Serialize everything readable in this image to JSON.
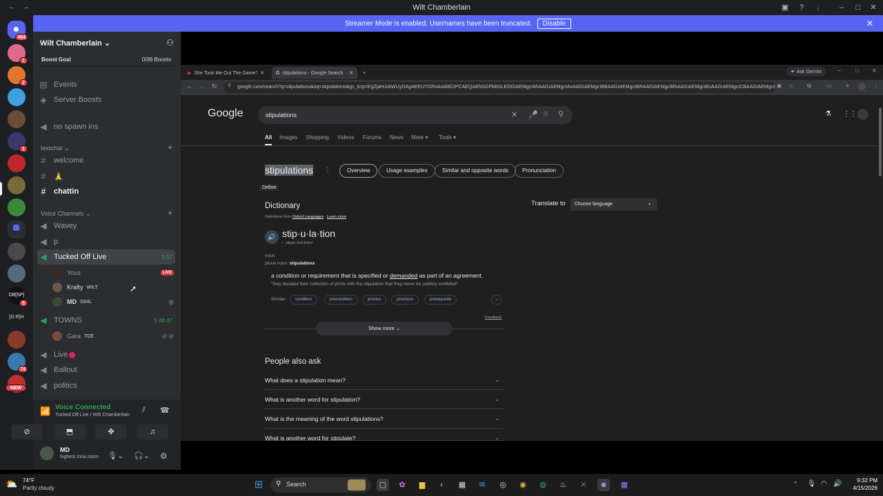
{
  "window": {
    "title": "Wilt Chamberlain"
  },
  "rail": {
    "home_badge": "464",
    "badges": [
      "1",
      "2",
      "1",
      "5",
      "74"
    ],
    "new_label": "NEW"
  },
  "banner": {
    "text": "Streamer Mode is enabled. Usernames have been truncated.",
    "button": "Disable"
  },
  "server": {
    "name": "Wilt Chamberlain",
    "boost_label": "Boost Goal",
    "boost_count": "0/36 Boosts"
  },
  "channels": {
    "events": "Events",
    "server_boosts": "Server Boosts",
    "no_spawn": "no spawn ins",
    "cat_text": "textchat",
    "welcome": "welcome",
    "emoji_channel": "🙏",
    "chattin": "chattin",
    "cat_voice": "Voice Channels",
    "wavey": "Wavey",
    "p": "p",
    "tucked": "Tucked Off Live",
    "tucked_time": "5:57",
    "yous": "Yous",
    "live_badge": "LIVE",
    "krafty": "Krafty",
    "krafty_tag": "WILT",
    "md": "MD",
    "md_tag": "SS4L",
    "towns": "TOWNS",
    "towns_time": "5:48:47",
    "gara": "Gara",
    "gara_tag": "TDE",
    "live": "Live",
    "ballout": "Ballout",
    "politics": "politics"
  },
  "voice": {
    "status": "Voice Connected",
    "location": "Tucked Off Live / Wilt Chamberlain"
  },
  "user": {
    "name": "MD",
    "status": "highest inna room"
  },
  "browser": {
    "tab1": "She Took Me Out The Game?! '",
    "tab2": "stipulations - Google Search",
    "gemini": "Ask Gemini",
    "url": "google.com/search?q=stipulations&oq=stipulations&gs_lcrp=EgZjaHJvbWUyDAgAEEUYORxAxiABDIPCAEQABhGGPkBGLEDGIAEMgcIAhAAGIAEMgcIAxAAGIAEMgcIBBAAGIAEMgcIBRAAGIAEMgcIBhAAGIAEMgcIBxAAGIAEMgcICBAAGIAEMgcIC..."
  },
  "google": {
    "logo": "Google",
    "query": "stipulations",
    "tabs": [
      "All",
      "Images",
      "Shopping",
      "Videos",
      "Forums",
      "News",
      "More ▾",
      "Tools ▾"
    ],
    "heading": "stipulations",
    "define": "Define",
    "chips": [
      "Overview",
      "Usage examples",
      "Similar and opposite words",
      "Pronunciation"
    ],
    "dict_title": "Dictionary",
    "dict_source": "Definitions from",
    "oxford": "Oxford Languages",
    "learn_more": "Learn more",
    "word": "stip·u·la·tion",
    "phonetic": "/ ˌstipyəˈlāSH(ə)n/",
    "pos": "noun",
    "plural_label": "plural noun:",
    "plural": "stipulations",
    "def_pre": "a condition or requirement that is specified or",
    "def_link": "demanded",
    "def_post": "as part of an agreement.",
    "example": "\"they donated their collection of prints with the stipulation that they never be publicly exhibited\"",
    "similar_label": "Similar:",
    "similar": [
      "condition",
      "precondition",
      "proviso",
      "provision",
      "prerequisite"
    ],
    "feedback": "Feedback",
    "show_more": "Show more",
    "translate_label": "Translate to",
    "choose_lang": "Choose language",
    "paa_title": "People also ask",
    "paa": [
      "What does a stipulation mean?",
      "What is another word for stipulation?",
      "What is the meaning of the word stipulations?",
      "What is another word for stipulate?"
    ]
  },
  "taskbar": {
    "temp": "74°F",
    "weather": "Partly cloudy",
    "search": "Search",
    "time": "9:32 PM",
    "date": "4/15/2026"
  }
}
